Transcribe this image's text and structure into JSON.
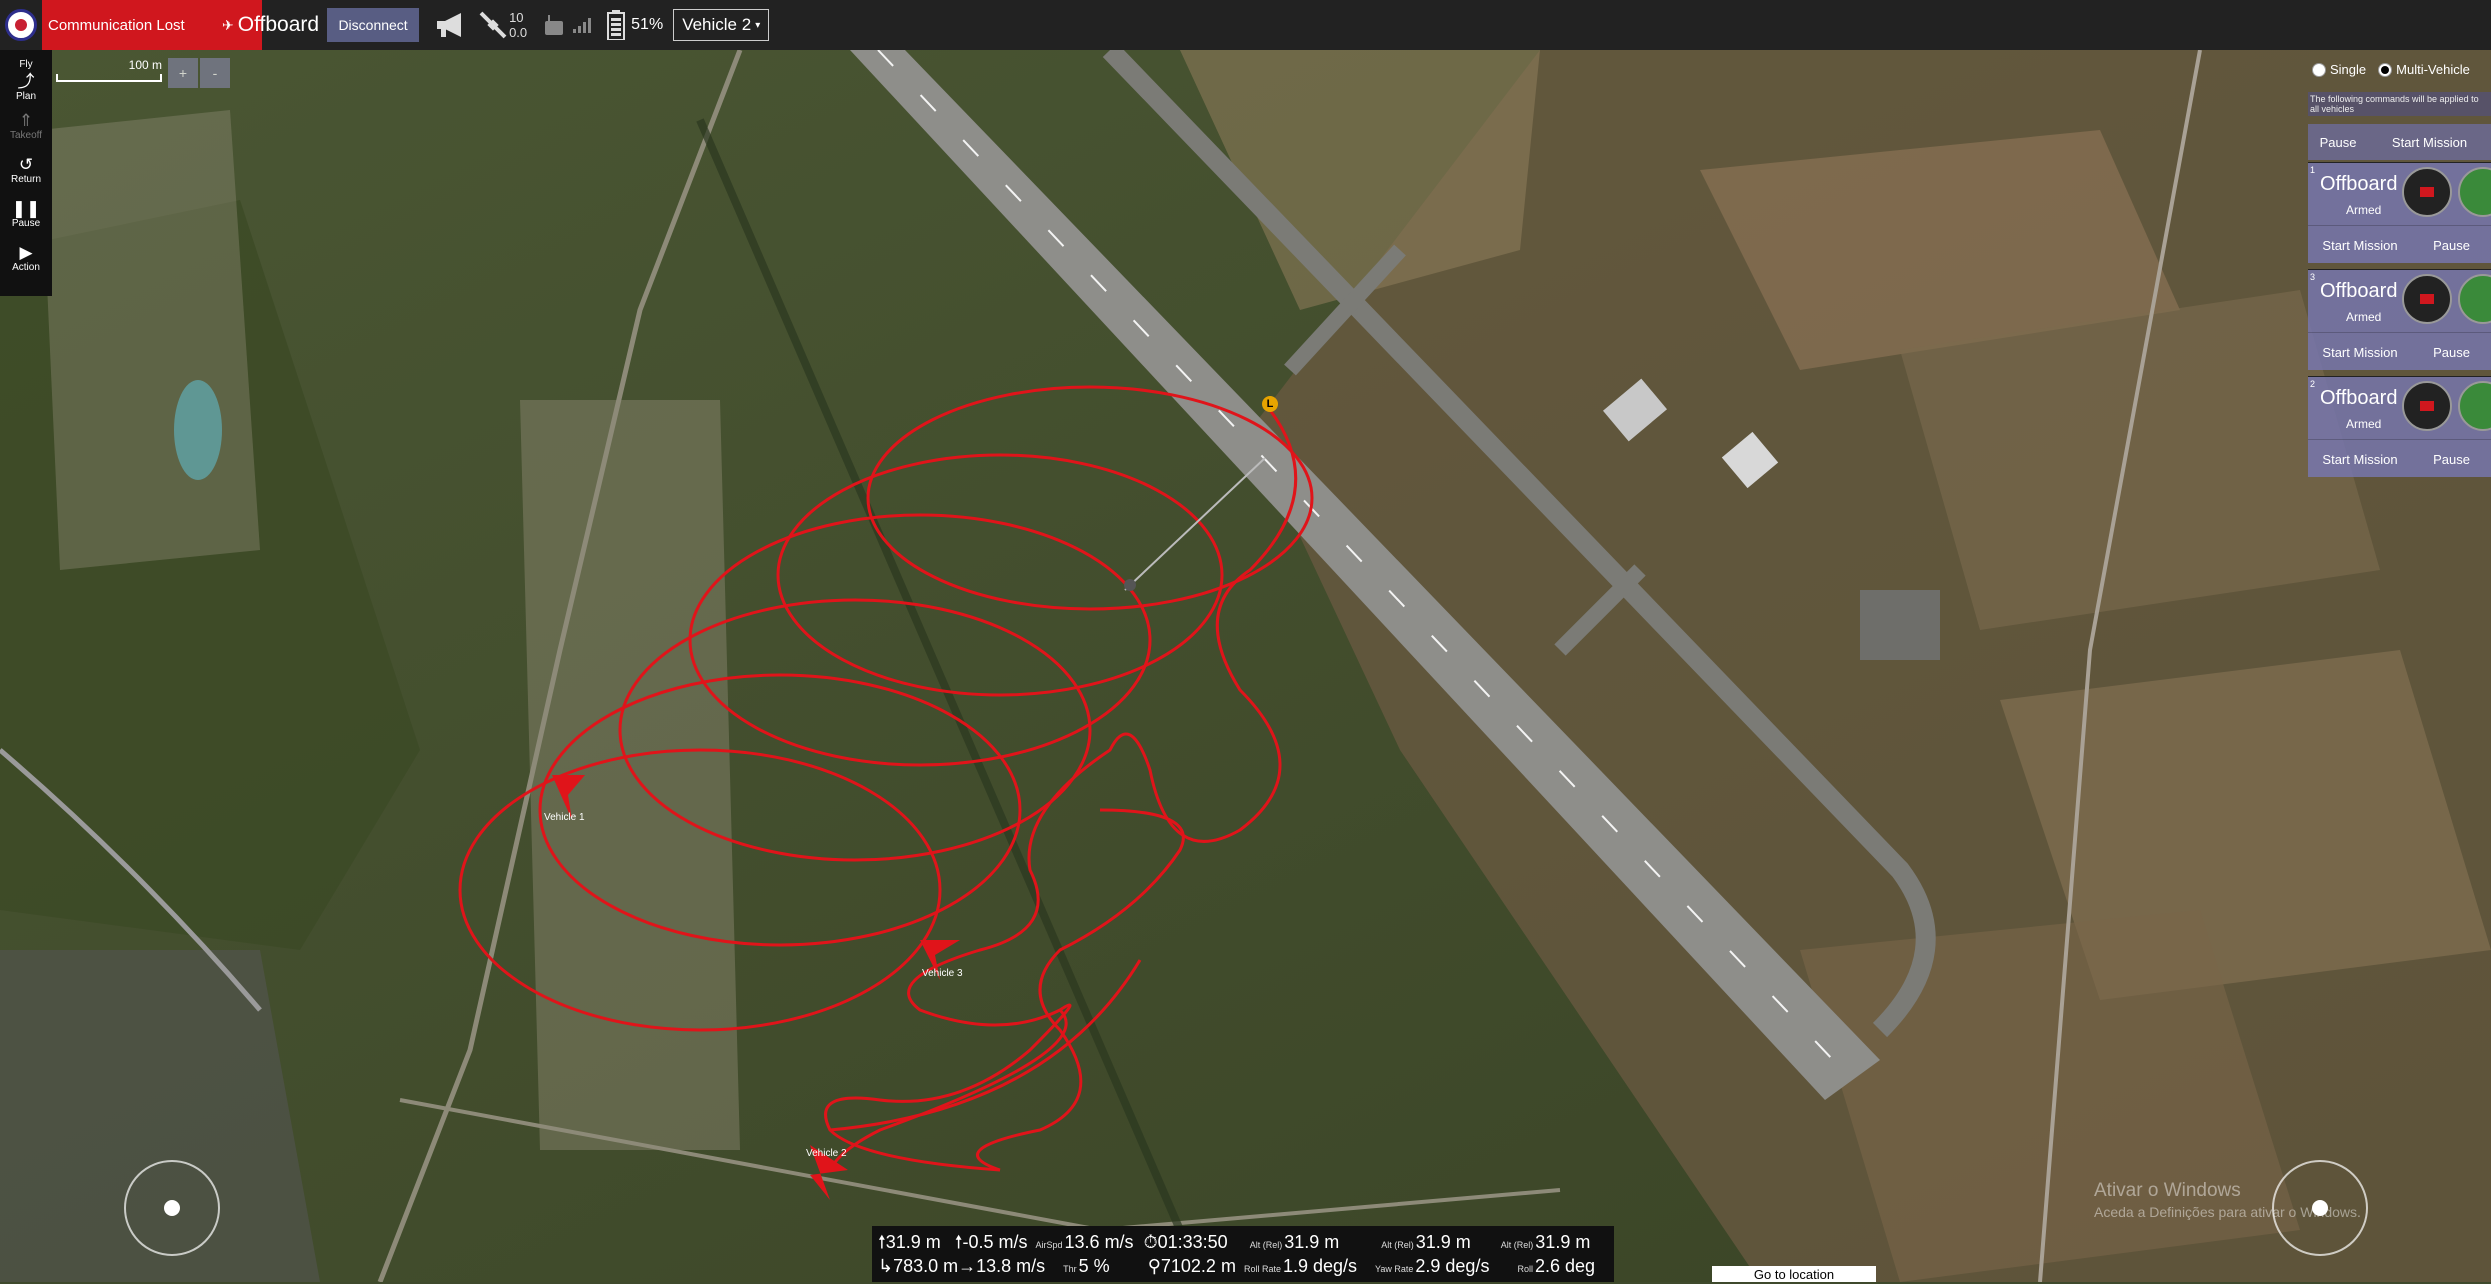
{
  "toolbar": {
    "status": "Communication Lost",
    "flight_mode": "Offboard",
    "disconnect_label": "Disconnect",
    "gps_count": "10",
    "gps_hdop": "0.0",
    "battery_percent": "51%",
    "active_vehicle": "Vehicle 2"
  },
  "toolstrip": {
    "items": [
      {
        "label": "Fly"
      },
      {
        "label": "Plan"
      },
      {
        "label": "Takeoff"
      },
      {
        "label": "Return"
      },
      {
        "label": "Pause"
      },
      {
        "label": "Action"
      }
    ]
  },
  "map": {
    "scale_label": "100 m",
    "zoom_in": "+",
    "zoom_out": "-",
    "vehicles": [
      {
        "label": "Vehicle 1"
      },
      {
        "label": "Vehicle 3"
      },
      {
        "label": "Vehicle 2"
      }
    ],
    "home_marker": "L",
    "goto_location": "Go to location",
    "path_color": "#e0141a"
  },
  "multi_vehicle": {
    "single_label": "Single",
    "multi_label": "Multi-Vehicle",
    "selected": "Multi-Vehicle",
    "note": "The following commands will be applied to all vehicles",
    "all_pause": "Pause",
    "all_start": "Start Mission",
    "vehicles": [
      {
        "id": "1",
        "mode": "Offboard",
        "state": "Armed",
        "start": "Start Mission",
        "pause": "Pause"
      },
      {
        "id": "3",
        "mode": "Offboard",
        "state": "Armed",
        "start": "Start Mission",
        "pause": "Pause"
      },
      {
        "id": "2",
        "mode": "Offboard",
        "state": "Armed",
        "start": "Start Mission",
        "pause": "Pause"
      }
    ]
  },
  "telemetry": {
    "altitude": "31.9 m",
    "vertical_speed": "-0.5 m/s",
    "airspeed_label": "AirSpd",
    "airspeed": "13.6 m/s",
    "flight_time": "01:33:50",
    "alt_rel_label": "Alt (Rel)",
    "alt_rel_1": "31.9 m",
    "alt_rel_2": "31.9 m",
    "alt_rel_3": "31.9 m",
    "distance_home": "783.0 m",
    "ground_speed": "13.8 m/s",
    "throttle_label": "Thr",
    "throttle": "5 %",
    "flight_distance": "7102.2 m",
    "roll_rate_label": "Roll Rate",
    "roll_rate": "1.9 deg/s",
    "yaw_rate_label": "Yaw Rate",
    "yaw_rate": "2.9 deg/s",
    "roll_label": "Roll",
    "roll": "2.6 deg"
  },
  "watermark": {
    "line1": "Ativar o Windows",
    "line2": "Aceda a Definições para ativar o Windows."
  }
}
